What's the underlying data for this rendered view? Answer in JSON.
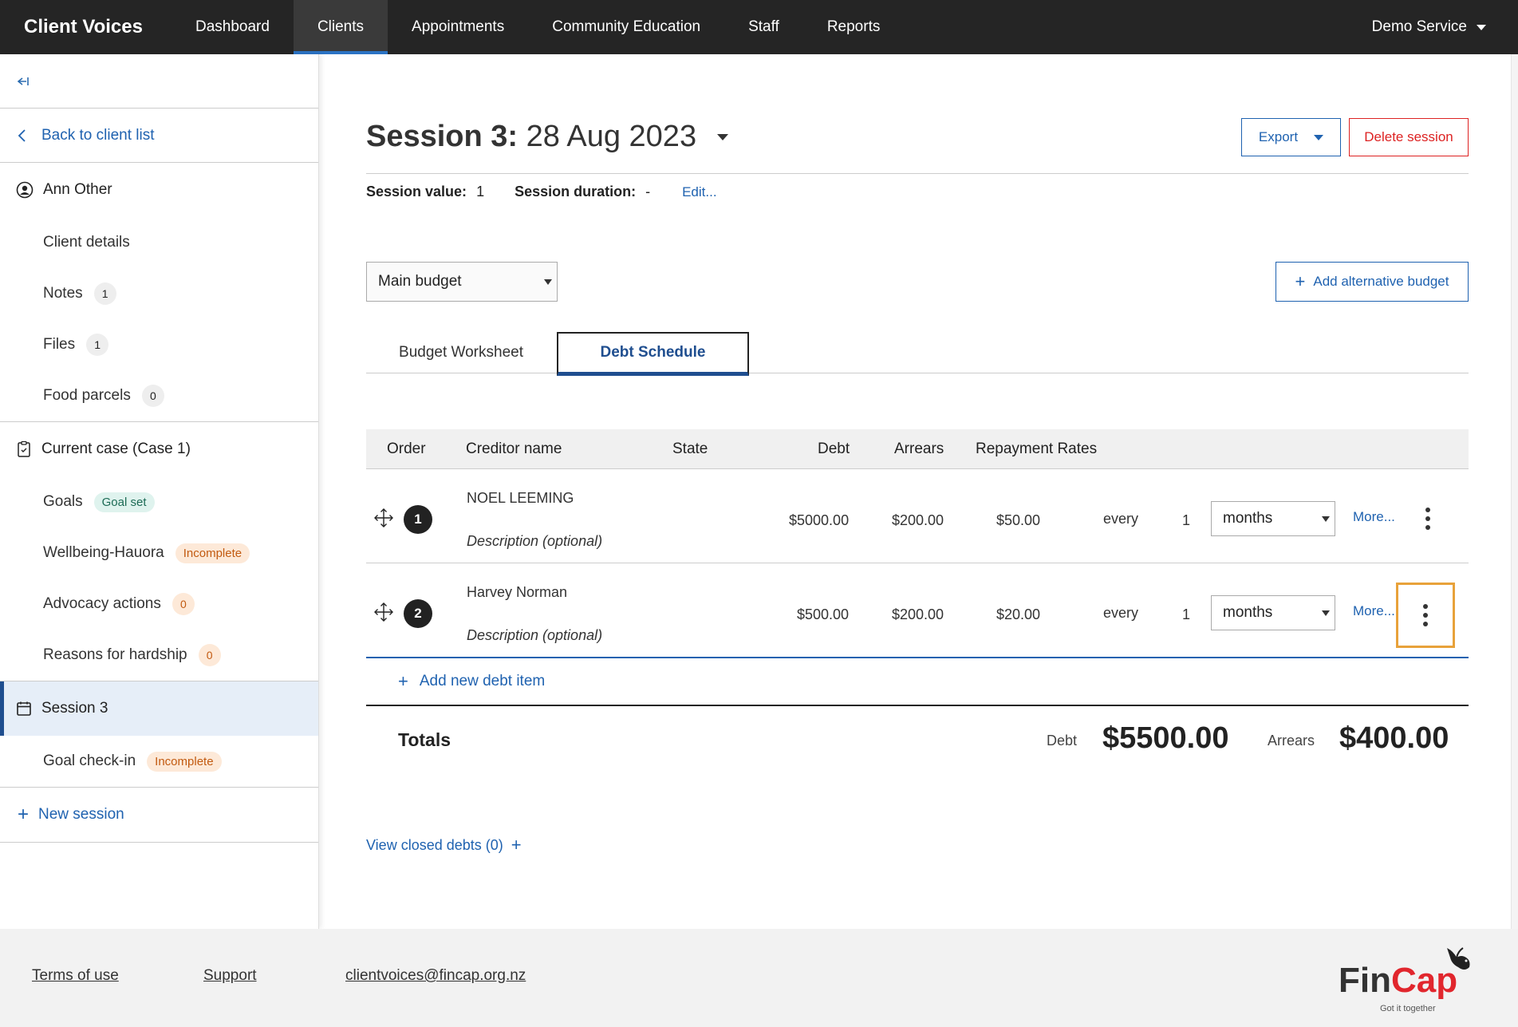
{
  "nav": {
    "brand": "Client Voices",
    "items": [
      "Dashboard",
      "Clients",
      "Appointments",
      "Community Education",
      "Staff",
      "Reports"
    ],
    "active": "Clients",
    "service": "Demo Service"
  },
  "sidebar": {
    "collapse_icon": "collapse-left-icon",
    "back": "Back to client list",
    "client_name": "Ann Other",
    "client_items": [
      {
        "label": "Client details"
      },
      {
        "label": "Notes",
        "count": "1"
      },
      {
        "label": "Files",
        "count": "1"
      },
      {
        "label": "Food parcels",
        "count": "0"
      }
    ],
    "case_title": "Current case (Case 1)",
    "case_items": [
      {
        "label": "Goals",
        "badge": "Goal set"
      },
      {
        "label": "Wellbeing-Hauora",
        "badge": "Incomplete"
      },
      {
        "label": "Advocacy actions",
        "count": "0"
      },
      {
        "label": "Reasons for hardship",
        "count": "0"
      }
    ],
    "session_title": "Session 3",
    "session_items": [
      {
        "label": "Goal check-in",
        "badge": "Incomplete"
      }
    ],
    "new_session": "New session"
  },
  "session": {
    "title_bold": "Session 3:",
    "title_date": "28 Aug 2023",
    "export_label": "Export",
    "delete_label": "Delete session",
    "value_label": "Session value:",
    "value": "1",
    "duration_label": "Session duration:",
    "duration": "-",
    "edit_label": "Edit..."
  },
  "budget": {
    "selected": "Main budget",
    "add_alt_label": "Add alternative budget"
  },
  "tabs": [
    "Budget Worksheet",
    "Debt Schedule"
  ],
  "active_tab": "Debt Schedule",
  "table": {
    "headers": [
      "Order",
      "Creditor name",
      "State",
      "Debt",
      "Arrears",
      "Repayment Rates"
    ],
    "rows": [
      {
        "order": "1",
        "creditor": "NOEL LEEMING",
        "description_placeholder": "Description (optional)",
        "debt": "$5000.00",
        "arrears": "$200.00",
        "rate": "$50.00",
        "every": "every",
        "interval": "1",
        "unit": "months",
        "more": "More..."
      },
      {
        "order": "2",
        "creditor": "Harvey Norman",
        "description_placeholder": "Description (optional)",
        "debt": "$500.00",
        "arrears": "$200.00",
        "rate": "$20.00",
        "every": "every",
        "interval": "1",
        "unit": "months",
        "more": "More..."
      }
    ],
    "add_label": "Add new debt item"
  },
  "totals": {
    "label": "Totals",
    "debt_label": "Debt",
    "debt_value": "$5500.00",
    "arrears_label": "Arrears",
    "arrears_value": "$400.00"
  },
  "closed_debts": "View closed debts (0)",
  "footer": {
    "links": [
      "Terms of use",
      "Support",
      "clientvoices@fincap.org.nz"
    ],
    "logo_fin": "Fin",
    "logo_cap": "Cap",
    "logo_tagline": "Got it together"
  },
  "colors": {
    "nav_bg": "#252525",
    "accent": "#1f62b0",
    "danger": "#dd2222",
    "focus": "#e8a23a"
  }
}
